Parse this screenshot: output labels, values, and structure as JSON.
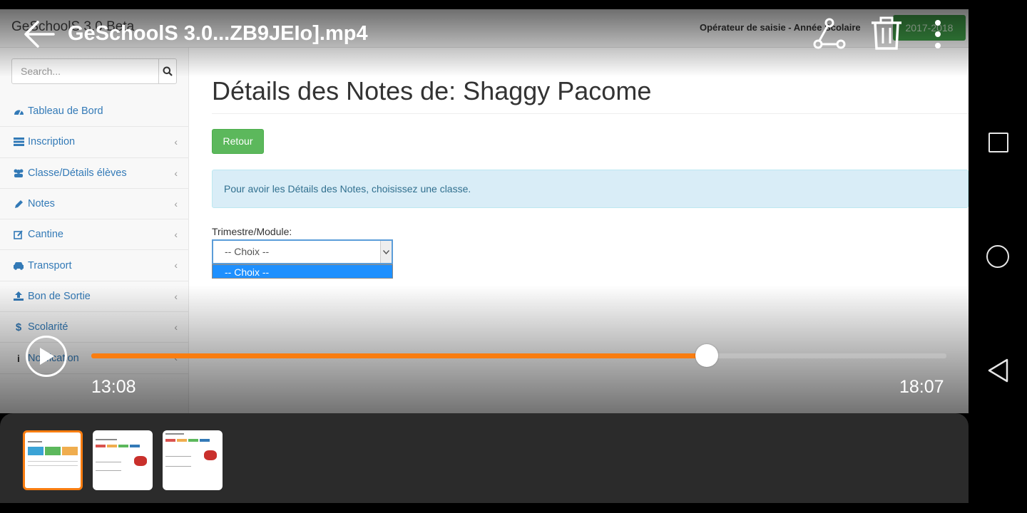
{
  "player": {
    "title": "GeSchoolS 3.0...ZB9JEIo].mp4",
    "current_time": "13:08",
    "duration": "18:07",
    "progress_fraction": 0.72,
    "accent_color": "#f97d10",
    "icons": [
      "back-arrow-icon",
      "share-icon",
      "trash-icon",
      "more-vert-icon",
      "play-icon"
    ]
  },
  "app": {
    "brand": "GeSchoolS 3.0 Beta",
    "operator": "Opérateur de saisie - Année Scolaire",
    "year": "2017-2018",
    "search": {
      "placeholder": "Search..."
    },
    "nav": [
      {
        "label": "Tableau de Bord",
        "icon": "dashboard-icon"
      },
      {
        "label": "Inscription",
        "icon": "list-icon"
      },
      {
        "label": "Classe/Détails élèves",
        "icon": "users-icon"
      },
      {
        "label": "Notes",
        "icon": "pencil-icon"
      },
      {
        "label": "Cantine",
        "icon": "edit-icon"
      },
      {
        "label": "Transport",
        "icon": "car-icon"
      },
      {
        "label": "Bon de Sortie",
        "icon": "upload-icon"
      },
      {
        "label": "Scolarité",
        "icon": "dollar-icon"
      },
      {
        "label": "Notification",
        "icon": "info-icon"
      }
    ],
    "page_title": "Détails des Notes de: Shaggy Pacome",
    "retour_label": "Retour",
    "alert_text": "Pour avoir les Détails des Notes, choisissez une classe.",
    "trimestre_label": "Trimestre/Module:",
    "select_value": "-- Choix --",
    "select_option": "-- Choix --"
  },
  "thumbnails": [
    {
      "selected": true
    },
    {
      "selected": false
    },
    {
      "selected": false
    }
  ],
  "system_nav": [
    "recent-apps-icon",
    "home-icon",
    "back-icon"
  ]
}
